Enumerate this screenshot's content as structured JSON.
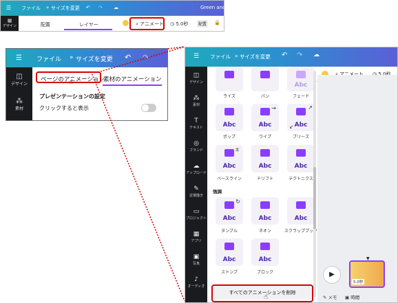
{
  "panel_top": {
    "menu_icon": "menu-icon",
    "file": "ファイル",
    "resize": "サイズを変更",
    "title_partial": "Green and Y",
    "tabs": [
      "配置",
      "レイヤー"
    ],
    "animate": "アニメート",
    "duration": "5.0秒",
    "arrange": "配置",
    "sidebar_label": "デザイン"
  },
  "panel_zoom": {
    "file": "ファイル",
    "resize": "サイズを変更",
    "side_items": [
      "デザイン",
      "素材"
    ],
    "tab_page_animation": "ページのアニメーション",
    "tab_element_animation": "素材のアニメーション",
    "presentation_settings": "プレゼンテーションの設定",
    "click_to_show": "クリックすると表示"
  },
  "panel_main": {
    "file": "ファイル",
    "resize": "サイズを変更",
    "animate": "アニメート",
    "duration": "5.0秒",
    "sidebar": [
      "デザイン",
      "素材",
      "テキスト",
      "ブランド",
      "アップロード",
      "近場描き",
      "プロジェクト",
      "アプリ",
      "写真",
      "オーディオ"
    ],
    "row1_labels": [
      "ライズ",
      "パン",
      "フェード"
    ],
    "row2_labels": [
      "ポップ",
      "ワイプ",
      "ブリーズ"
    ],
    "row3_labels": [
      "ベースライン",
      "ドリフト",
      "テクトニクス"
    ],
    "section_emphasis": "強調",
    "row4_labels": [
      "タンブル",
      "ネオン",
      "スクラップブック"
    ],
    "row5_labels": [
      "ストンプ",
      "ブロック"
    ],
    "card_text": "Abc",
    "remove_all": "すべてのアニメーションを削除",
    "thumb_duration": "5.0秒",
    "memo": "メモ",
    "time": "時間"
  },
  "colors": {
    "accent": "#8b3dff",
    "highlight_red": "#d40000",
    "sidebar": "#1a1b1e"
  }
}
